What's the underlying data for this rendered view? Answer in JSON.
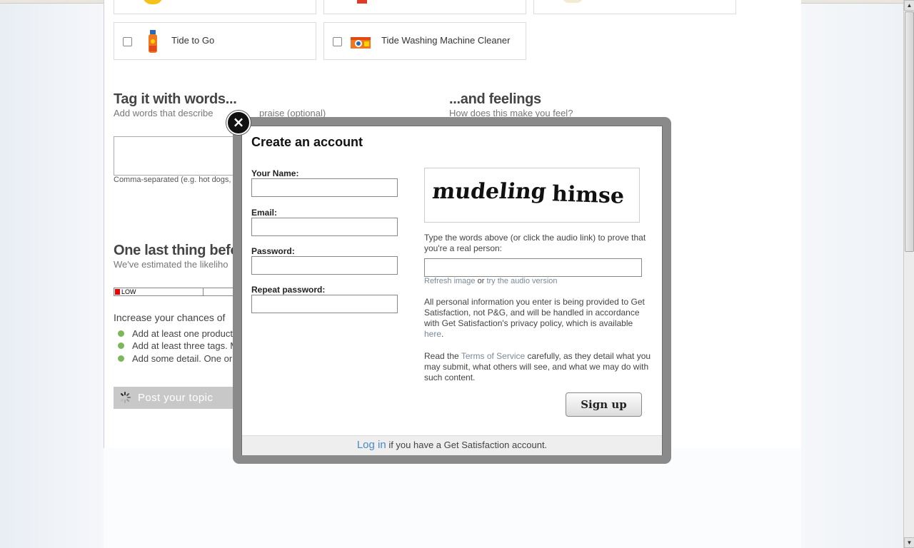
{
  "products": [
    {
      "name": "Tide to Go",
      "icon": "tide-to-go-pen-icon"
    },
    {
      "name": "Tide Washing Machine Cleaner",
      "icon": "tide-washing-machine-cleaner-box-icon"
    }
  ],
  "tags": {
    "heading": "Tag it with words...",
    "subheading_visible": "Add words that describe",
    "subheading_tail": "praise (optional)",
    "hint": "Comma-separated (e.g. hot dogs, ca"
  },
  "feelings": {
    "heading": "...and feelings",
    "subheading": "How does this make you feel?"
  },
  "last_thing": {
    "heading": "One last thing before",
    "subheading": "We've estimated the likeliho",
    "meter_label": "LOW",
    "meter_level": "low",
    "meter_fill_fraction": 0.04,
    "increase_text": "Increase your chances of",
    "tips": [
      "Add at least one product or",
      "Add at least three tags. Mo",
      "Add some detail. One or tw"
    ],
    "tip_dot_color": "#7cb85a"
  },
  "post_button": {
    "label": "Post your topic"
  },
  "modal": {
    "title": "Create an account",
    "close_glyph": "×",
    "fields": [
      {
        "label": "Your Name:",
        "value": ""
      },
      {
        "label": "Email:",
        "value": ""
      },
      {
        "label": "Password:",
        "value": ""
      },
      {
        "label": "Repeat password:",
        "value": ""
      }
    ],
    "captcha_words": [
      "mudeling",
      "himse"
    ],
    "captcha_instructions": "Type the words above (or click the audio link) to prove that you're a real person:",
    "captcha_value": "",
    "refresh_link": "Refresh image",
    "or_text": "or",
    "audio_link": "try the audio version",
    "privacy_text": "All personal information you enter is being provided to Get Satisfaction, not P&G, and will be handled in accordance with Get Satisfaction's privacy policy, which is available",
    "privacy_link": "here",
    "tos_prefix": "Read the",
    "tos_link": "Terms of Service",
    "tos_suffix": "carefully, as they detail what you may submit, what others will see, and what we may do with such content.",
    "signup_button": "Sign up",
    "footer_login": "Log in",
    "footer_text": "if you have a Get Satisfaction account."
  },
  "colors": {
    "link": "#4a8ac0",
    "muted_link": "#7a8a9a",
    "modal_frame": "#8a8a8a",
    "meter_fill": "#ee0000"
  }
}
